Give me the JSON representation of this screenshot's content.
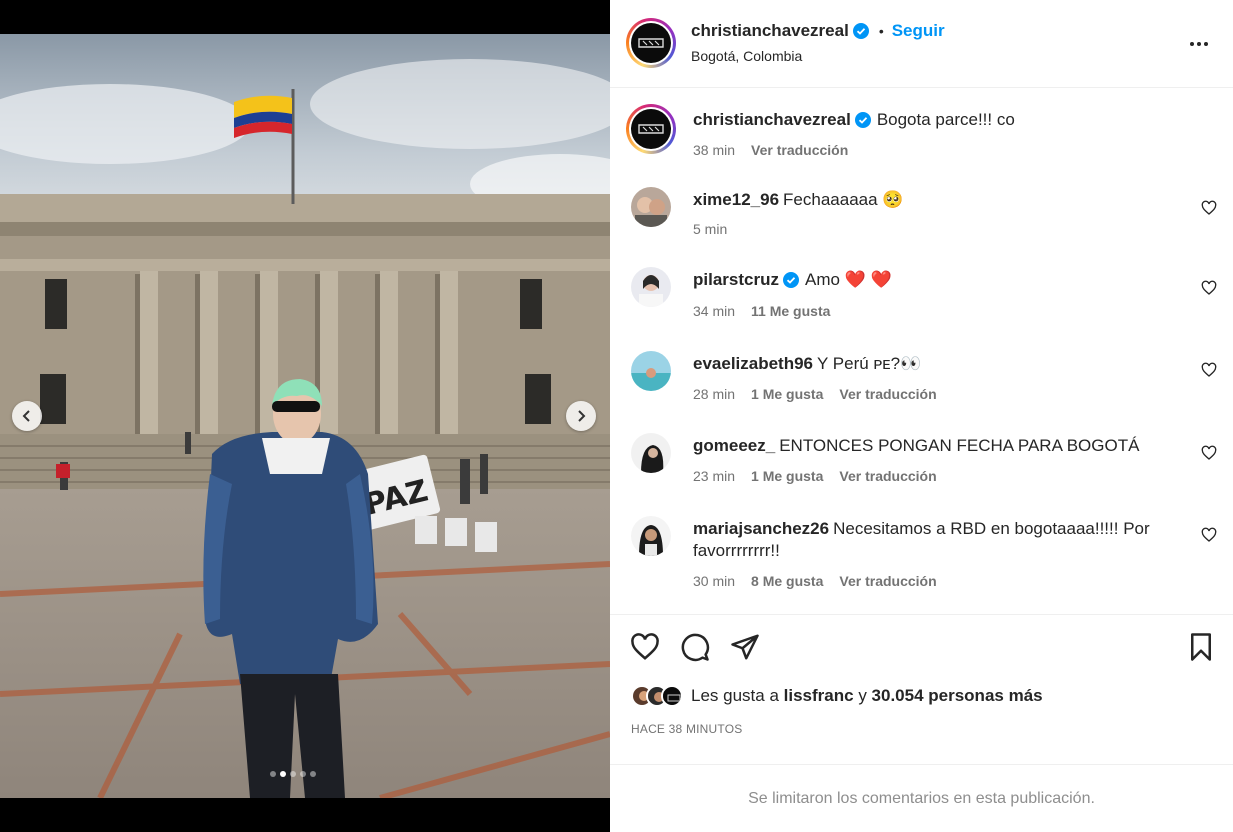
{
  "post": {
    "author": "christianchavezreal",
    "follow_label": "Seguir",
    "bullet": "•",
    "location": "Bogotá, Colombia",
    "carousel": {
      "slide_count": 5,
      "active_slide": 2
    }
  },
  "photo_sign": "PAZ",
  "caption": {
    "username": "christianchavezreal",
    "text": "Bogota parce!!! co",
    "time": "38 min",
    "translate": "Ver traducción"
  },
  "comments": [
    {
      "username": "xime12_96",
      "text": "Fechaaaaaa 🥺",
      "time": "5 min",
      "likes": "",
      "translate": ""
    },
    {
      "username": "pilarstcruz",
      "verified": true,
      "text": "Amo ❤️ ❤️",
      "time": "34 min",
      "likes": "11 Me gusta",
      "translate": ""
    },
    {
      "username": "evaelizabeth96",
      "text": "Y Perú ᴘᴇ?👀",
      "time": "28 min",
      "likes": "1 Me gusta",
      "translate": "Ver traducción"
    },
    {
      "username": "gomeeez_",
      "text": "ENTONCES PONGAN FECHA PARA BOGOTÁ",
      "time": "23 min",
      "likes": "1 Me gusta",
      "translate": "Ver traducción"
    },
    {
      "username": "mariajsanchez26",
      "text": "Necesitamos a RBD en bogotaaaa!!!!! Por favorrrrrrrr!!",
      "time": "30 min",
      "likes": "8 Me gusta",
      "translate": "Ver traducción"
    }
  ],
  "likes": {
    "prefix": "Les gusta a",
    "user": "lissfranc",
    "joiner": "y",
    "others": "30.054 personas más"
  },
  "timestamp": "HACE 38 MINUTOS",
  "comments_limited": "Se limitaron los comentarios en esta publicación.",
  "colors": {
    "link": "#0095f6",
    "verified": "#0095f6",
    "heart": "#ed4956",
    "muted": "#737373"
  },
  "icons": [
    "chevron-left-icon",
    "chevron-right-icon",
    "verified-icon",
    "more-icon",
    "heart-icon",
    "comment-icon",
    "share-icon",
    "bookmark-icon"
  ]
}
